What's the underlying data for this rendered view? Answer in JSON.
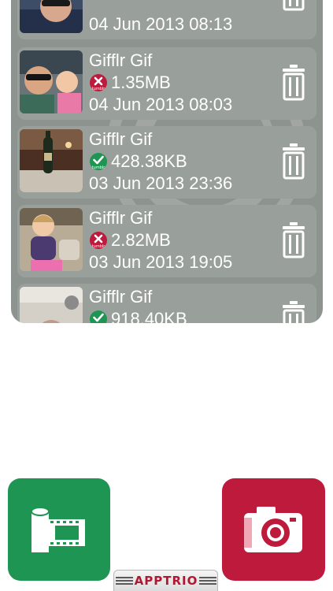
{
  "gif_list": [
    {
      "title": "",
      "size": "",
      "date": "04 Jun 2013 08:13",
      "tumblr_status": "unknown",
      "thumb_icon": "photo-thumbnail"
    },
    {
      "title": "Gifflr Gif",
      "size": "1.35MB",
      "date": "04 Jun 2013 08:03",
      "tumblr_status": "not-posted",
      "thumb_icon": "photo-thumbnail"
    },
    {
      "title": "Gifflr Gif",
      "size": "428.38KB",
      "date": "03 Jun 2013 23:36",
      "tumblr_status": "posted",
      "thumb_icon": "photo-thumbnail"
    },
    {
      "title": "Gifflr Gif",
      "size": "2.82MB",
      "date": "03 Jun 2013 19:05",
      "tumblr_status": "not-posted",
      "thumb_icon": "photo-thumbnail"
    },
    {
      "title": "Gifflr Gif",
      "size": "918.40KB",
      "date": "",
      "tumblr_status": "posted",
      "thumb_icon": "photo-thumbnail"
    }
  ],
  "status_badge_text": "tumblr",
  "icons": {
    "delete": "trash-icon",
    "posted": "check-icon",
    "not_posted": "x-icon",
    "film": "film-roll-icon",
    "camera": "camera-icon"
  },
  "bottom_bar": {
    "brand": "APPTRIO"
  },
  "colors": {
    "panel_bg": "#8d938e",
    "row_bg": "#99a09b",
    "posted_green": "#1e9552",
    "not_posted_red": "#be1a3c",
    "film_button": "#1e9552",
    "camera_button": "#be1a3c",
    "brand_red": "#b01832"
  }
}
